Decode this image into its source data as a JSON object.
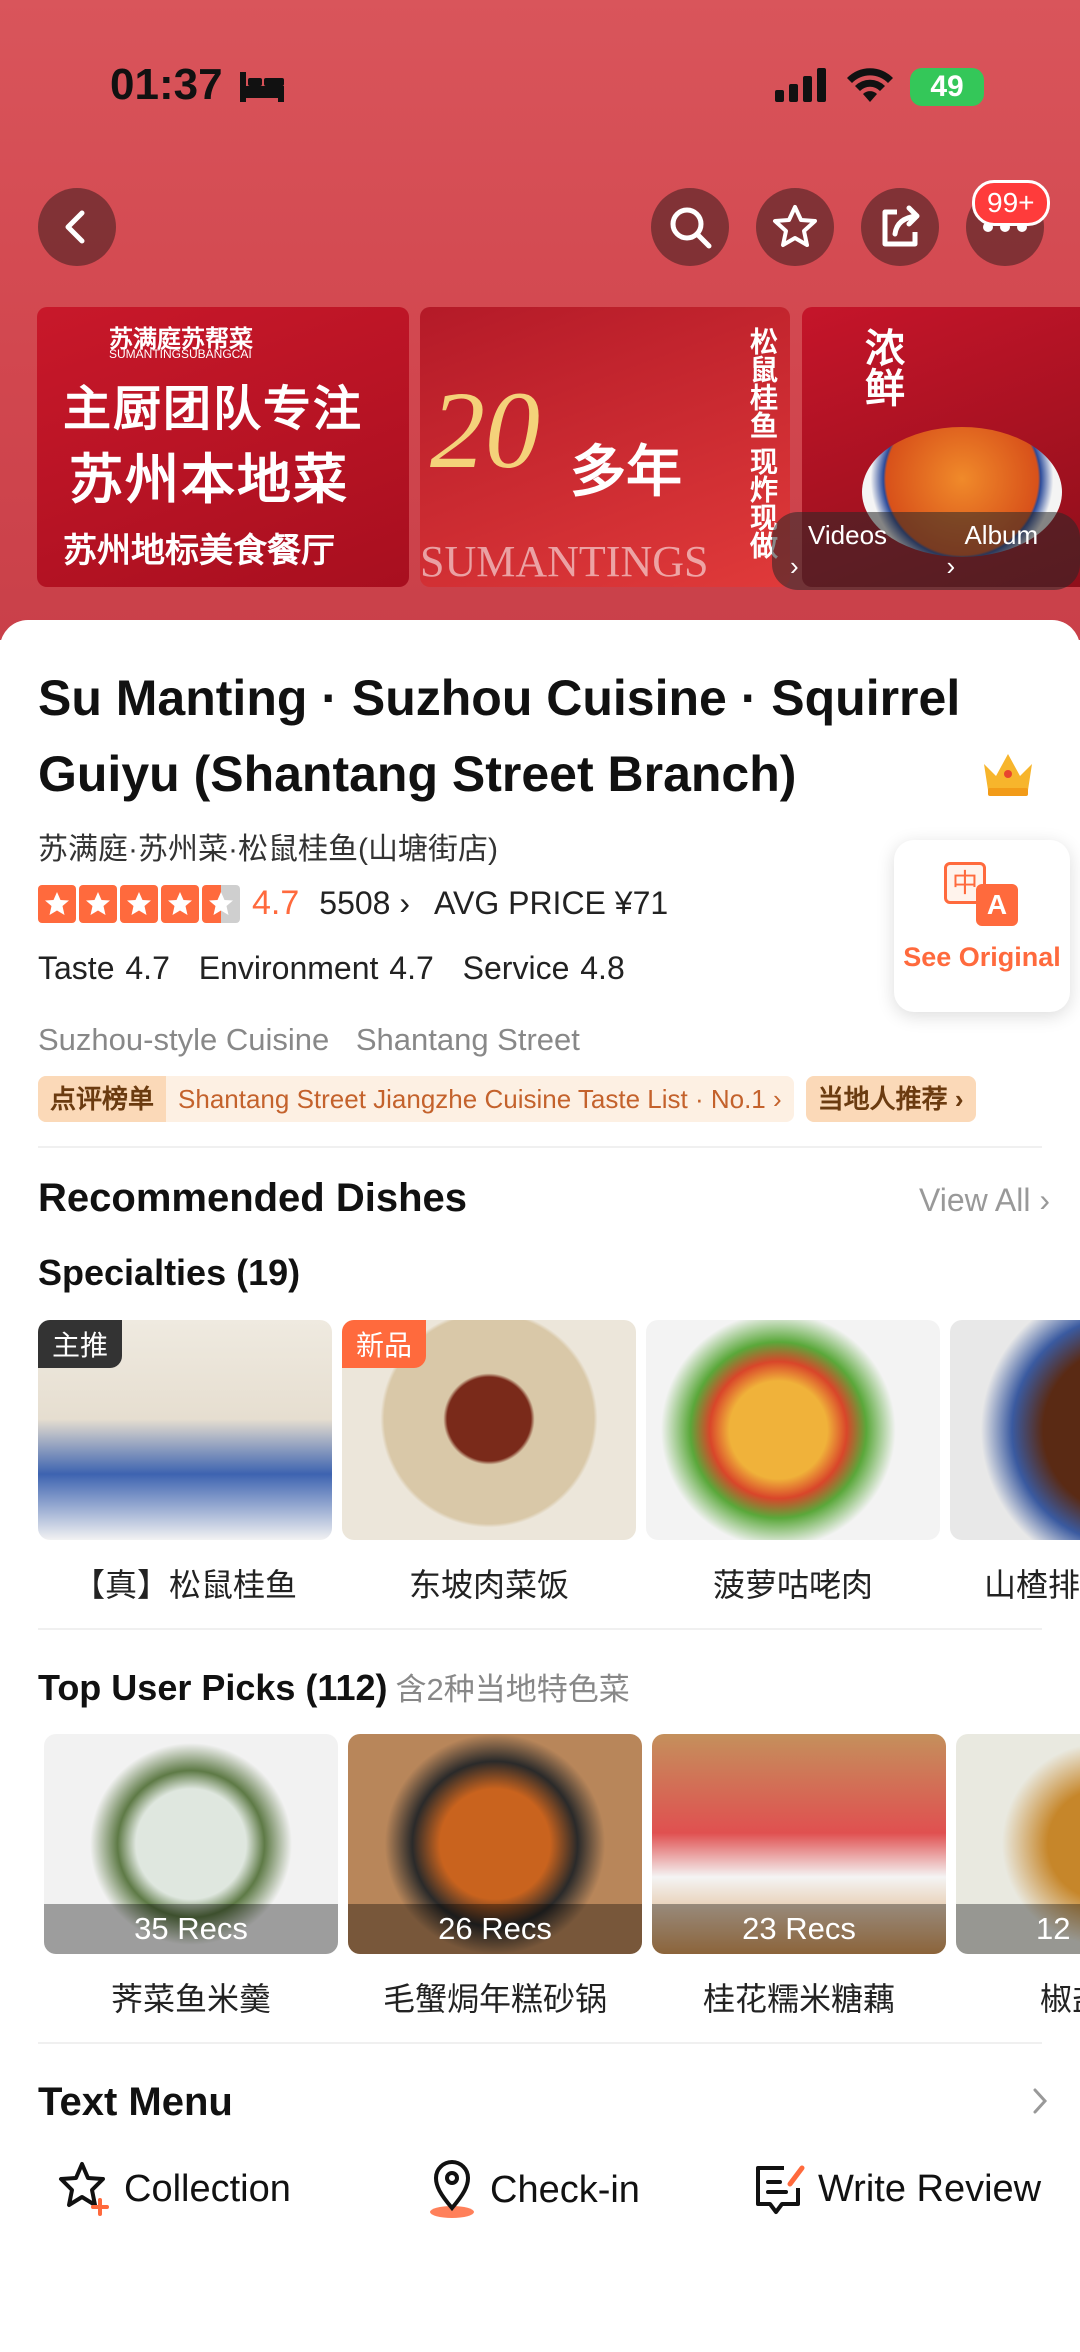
{
  "status_bar": {
    "time": "01:37",
    "battery": "49"
  },
  "header": {
    "more_badge": "99+"
  },
  "banners": {
    "b1_brand": "苏满庭苏帮菜",
    "b1_brand_en": "SUMANTINGSUBANGCAI",
    "b1_line1": "主厨团队专注",
    "b1_line2": "苏州本地菜",
    "b1_line3": "苏州地标美食餐厅",
    "b2_number": "20",
    "b2_suffix": "多年",
    "b2_vertical": "松鼠桂鱼 现炸现做",
    "b2_brand": "SUMANTINGS",
    "b3_vertical": "浓鲜"
  },
  "media": {
    "videos": "Videos",
    "album": "Album"
  },
  "restaurant": {
    "title": "Su Manting · Suzhou Cuisine · Squirrel Guiyu (Shantang Street Branch)",
    "subtitle": "苏满庭·苏州菜·松鼠桂鱼(山塘街店)",
    "rating": "4.7",
    "stars": 4.5,
    "review_count": "5508",
    "avg_price": "AVG PRICE ¥71",
    "taste": "Taste 4.7",
    "environment": "Environment 4.7",
    "service": "Service 4.8",
    "cuisine_tag": "Suzhou-style Cuisine",
    "area_tag": "Shantang Street",
    "ranking_tag": "点评榜单",
    "ranking_text": "Shantang Street Jiangzhe Cuisine Taste List · No.1",
    "local_tag": "当地人推荐"
  },
  "see_original": {
    "label": "See Original",
    "icon_text_1": "中",
    "icon_text_2": "A"
  },
  "recommended": {
    "title": "Recommended Dishes",
    "view_all": "View All",
    "specialties_title": "Specialties (19)",
    "specialties": [
      {
        "name": "【真】松鼠桂鱼",
        "tag": "主推"
      },
      {
        "name": "东坡肉菜饭",
        "tag": "新品"
      },
      {
        "name": "菠萝咕咾肉",
        "tag": ""
      },
      {
        "name": "山楂排",
        "tag": ""
      }
    ],
    "top_picks_title": "Top User Picks (112)",
    "top_picks_note": "含2种当地特色菜",
    "top_picks": [
      {
        "name": "荠菜鱼米羹",
        "recs": "35 Recs"
      },
      {
        "name": "毛蟹焗年糕砂锅",
        "recs": "26 Recs"
      },
      {
        "name": "桂花糯米糖藕",
        "recs": "23 Recs"
      },
      {
        "name": "椒盐",
        "recs": "12"
      }
    ]
  },
  "text_menu": {
    "title": "Text Menu"
  },
  "bottom_bar": {
    "collection": "Collection",
    "checkin": "Check-in",
    "write_review": "Write Review"
  }
}
